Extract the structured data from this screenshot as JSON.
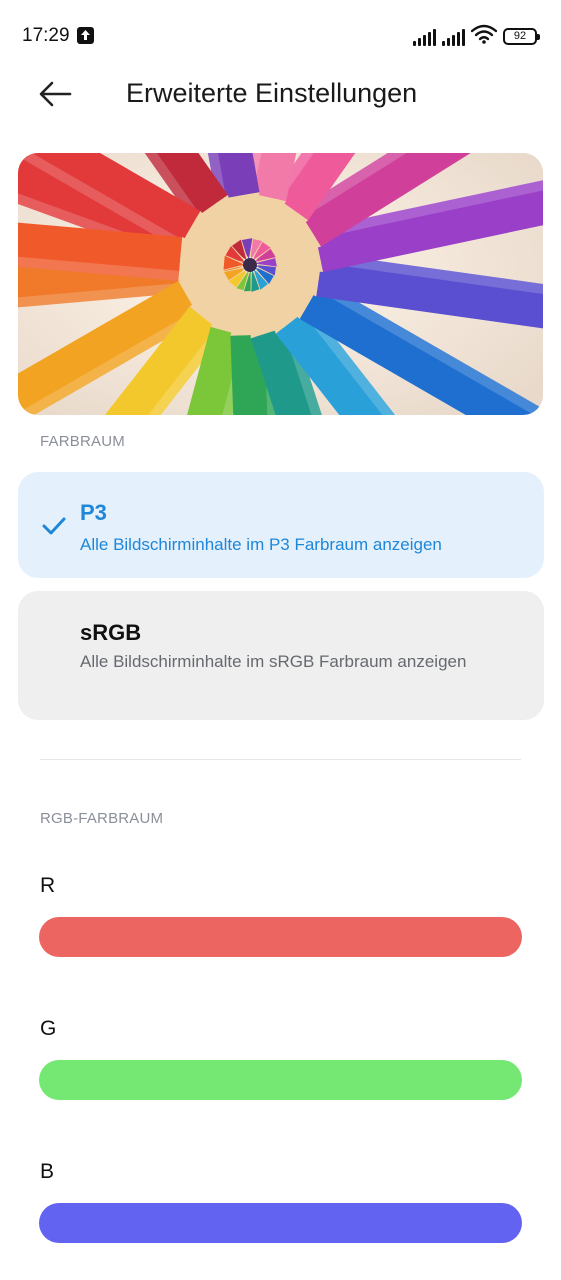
{
  "status_bar": {
    "time": "17:29",
    "battery": "92",
    "icons": [
      "upload-notification-icon",
      "signal-icon",
      "signal-icon",
      "wifi-icon",
      "battery-icon"
    ]
  },
  "header": {
    "back_icon": "back-arrow-icon",
    "title": "Erweiterte Einstellungen"
  },
  "hero_image": {
    "subject": "colored-pencils"
  },
  "color_space": {
    "section_label": "FARBRAUM",
    "options": [
      {
        "title": "P3",
        "description": "Alle Bildschirminhalte im P3 Farbraum anzeigen",
        "selected": true
      },
      {
        "title": "sRGB",
        "description": "Alle Bildschirminhalte im sRGB Farbraum anzeigen",
        "selected": false
      }
    ],
    "selected_color": "#1f86d8"
  },
  "rgb": {
    "section_label": "RGB-FARBRAUM",
    "channels": [
      {
        "label": "R",
        "color": "#ec6560"
      },
      {
        "label": "G",
        "color": "#74e873"
      },
      {
        "label": "B",
        "color": "#6363f2"
      }
    ]
  }
}
